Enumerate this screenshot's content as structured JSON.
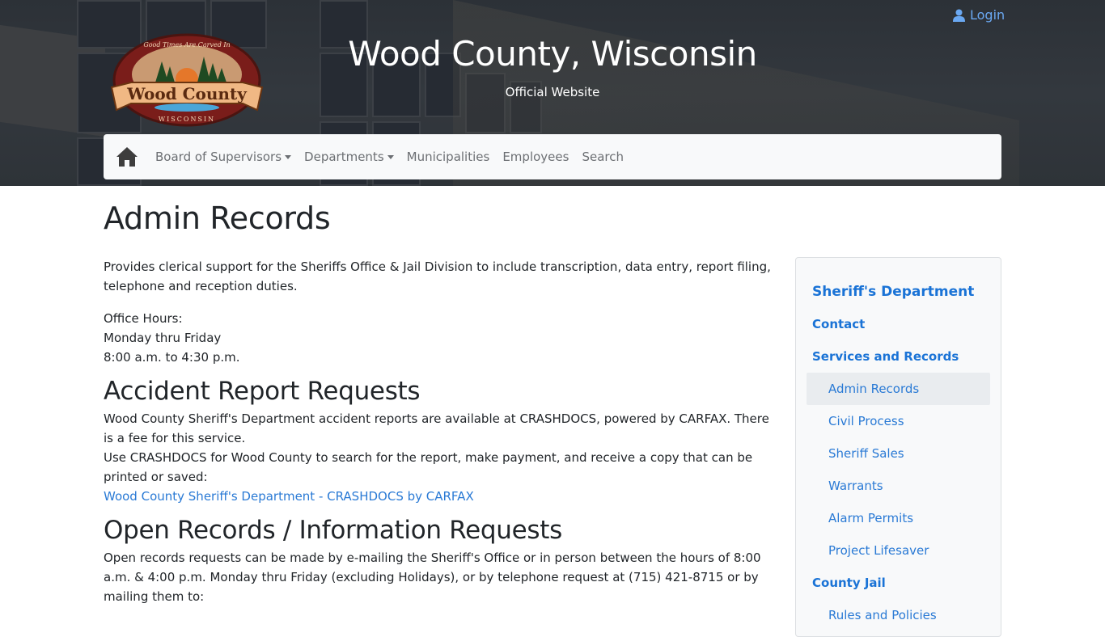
{
  "header": {
    "title": "Wood County, Wisconsin",
    "subtitle": "Official Website",
    "login_label": "Login",
    "logo": {
      "top_arc": "Good Times Are Carved In",
      "name": "Wood County",
      "bottom_arc": "WISCONSIN"
    }
  },
  "navbar": {
    "home_icon": "home-icon",
    "items": [
      {
        "label": "Board of Supervisors",
        "dropdown": true
      },
      {
        "label": "Departments",
        "dropdown": true
      },
      {
        "label": "Municipalities",
        "dropdown": false
      },
      {
        "label": "Employees",
        "dropdown": false
      },
      {
        "label": "Search",
        "dropdown": false
      }
    ]
  },
  "main": {
    "title": "Admin Records",
    "intro": "Provides clerical support for the Sheriffs Office & Jail Division to include transcription, data entry, report filing, telephone and reception duties.",
    "hours": {
      "label": "Office Hours:",
      "days": "Monday thru Friday",
      "time": "8:00 a.m. to 4:30 p.m."
    },
    "accident": {
      "heading": "Accident Report Requests",
      "line1": "Wood County Sheriff's Department accident reports are available at CRASHDOCS, powered by CARFAX. There is a fee for this service.",
      "line2": "Use CRASHDOCS for Wood County to search for the report, make payment, and receive a copy that can be printed or saved:",
      "link": "Wood County Sheriff's Department - CRASHDOCS by CARFAX"
    },
    "open_records": {
      "heading": "Open Records / Information Requests",
      "text": "Open records requests can be made by e-mailing the Sheriff's Office or in person between the hours of 8:00 a.m. & 4:00 p.m. Monday thru Friday (excluding Holidays), or by telephone request at (715) 421-8715 or by mailing them to:"
    }
  },
  "sidebar": {
    "heading": "Sheriff's Department",
    "items": [
      {
        "label": "Contact",
        "level": 1
      },
      {
        "label": "Services and Records",
        "level": 1
      },
      {
        "label": "Admin Records",
        "level": 2,
        "active": true
      },
      {
        "label": "Civil Process",
        "level": 2
      },
      {
        "label": "Sheriff Sales",
        "level": 2
      },
      {
        "label": "Warrants",
        "level": 2
      },
      {
        "label": "Alarm Permits",
        "level": 2
      },
      {
        "label": "Project Lifesaver",
        "level": 2
      },
      {
        "label": "County Jail",
        "level": 1
      },
      {
        "label": "Rules and Policies",
        "level": 2
      }
    ]
  },
  "colors": {
    "link": "#2a7ad5",
    "sidebar_heading": "#1a73d6",
    "login": "#6aa8f2",
    "banner": "#33383e",
    "navbar_bg": "#f8f9fa",
    "active_bg": "#e9ecef"
  }
}
